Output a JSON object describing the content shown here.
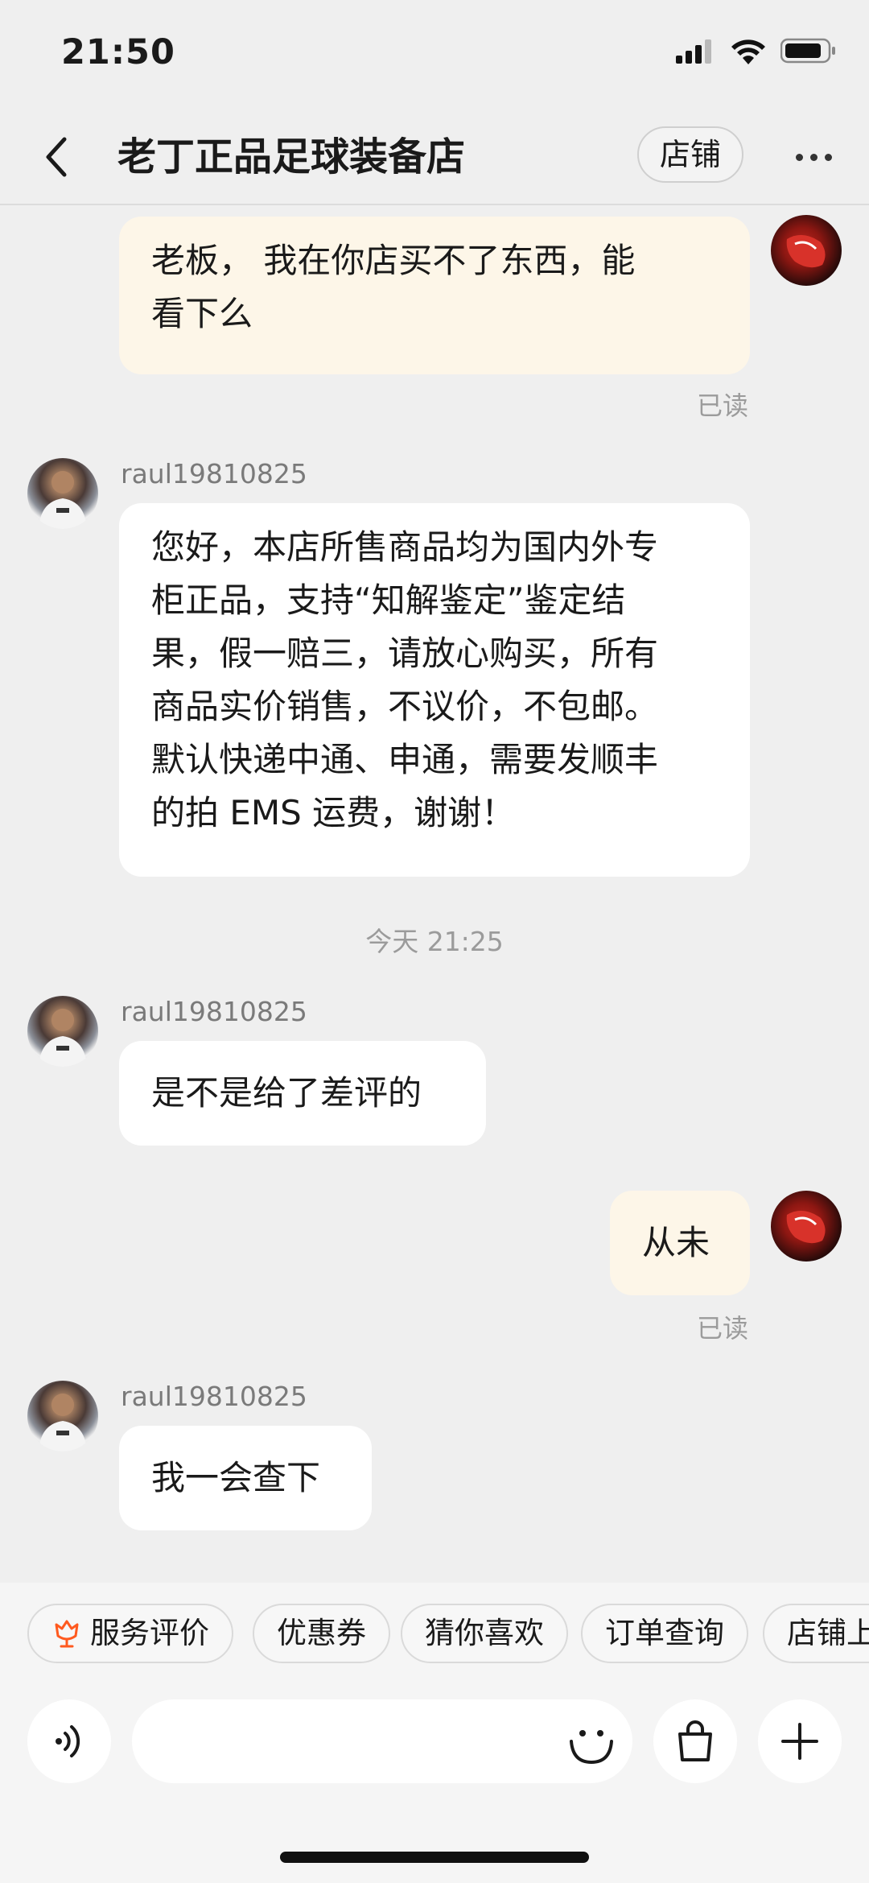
{
  "status_bar": {
    "time": "21:50",
    "icons": [
      "cellular-signal-icon",
      "wifi-icon",
      "battery-icon"
    ]
  },
  "header": {
    "back_icon": "chevron-left-icon",
    "title": "老丁正品足球装备店",
    "shop_button": "店铺",
    "more_icon": "more-dots-icon"
  },
  "messages": [
    {
      "from": "me",
      "avatar": "red-football-boot-avatar",
      "lines": [
        "老板， 我在你店买不了东西，能",
        "看下么"
      ],
      "status": "已读"
    },
    {
      "from": "them",
      "sender": "raul19810825",
      "avatar": "football-player-avatar",
      "lines": [
        "您好，本店所售商品均为国内外专",
        "柜正品，支持“知解鉴定”鉴定结",
        "果，假一赔三，请放心购买，所有",
        "商品实价销售，不议价，不包邮。",
        "默认快递中通、申通，需要发顺丰",
        "的拍 EMS 运费，谢谢！"
      ]
    },
    {
      "type": "time",
      "text": "今天 21:25"
    },
    {
      "from": "them",
      "sender": "raul19810825",
      "avatar": "football-player-avatar",
      "lines": [
        "是不是给了差评的"
      ]
    },
    {
      "from": "me",
      "avatar": "red-football-boot-avatar",
      "lines": [
        "从未"
      ],
      "status": "已读"
    },
    {
      "from": "them",
      "sender": "raul19810825",
      "avatar": "football-player-avatar",
      "lines": [
        "我一会查下"
      ]
    }
  ],
  "quick_actions": [
    {
      "label": "服务评价",
      "icon": "flower-rating-icon"
    },
    {
      "label": "优惠券"
    },
    {
      "label": "猜你喜欢"
    },
    {
      "label": "订单查询"
    },
    {
      "label": "店铺上"
    }
  ],
  "input_bar": {
    "voice_icon": "voice-icon",
    "placeholder": "",
    "emoji_icon": "emoji-smile-icon",
    "product_icon": "shopping-bag-icon",
    "plus_icon": "plus-icon"
  },
  "colors": {
    "background": "#efefef",
    "my_bubble": "#fdf6e8",
    "their_bubble": "#ffffff",
    "accent_orange": "#ff5a1f"
  }
}
